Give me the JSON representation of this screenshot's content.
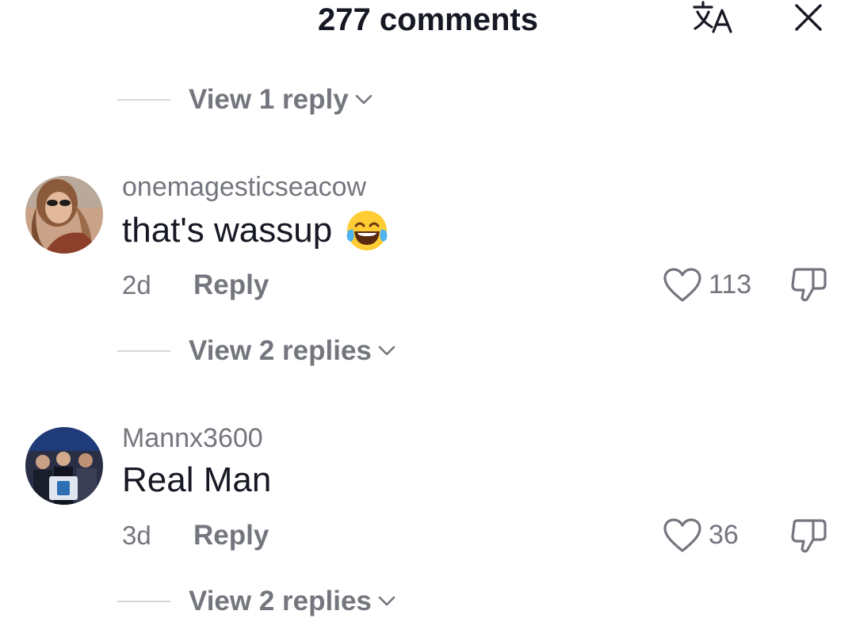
{
  "header": {
    "title": "277 comments",
    "translate_icon": "translate-icon",
    "close_icon": "close-icon"
  },
  "top_reply_link": {
    "label": "View 1 reply"
  },
  "comments": [
    {
      "username": "onemagesticseacow",
      "text": "that's wassup",
      "emoji": "face-with-tears-of-joy",
      "time": "2d",
      "reply_label": "Reply",
      "likes": "113",
      "view_replies": "View 2 replies"
    },
    {
      "username": "Mannx3600",
      "text": "Real Man",
      "time": "3d",
      "reply_label": "Reply",
      "likes": "36",
      "view_replies": "View 2 replies"
    }
  ],
  "colors": {
    "primary_text": "#161823",
    "secondary_text": "#74767e",
    "divider": "#d6d6da"
  }
}
